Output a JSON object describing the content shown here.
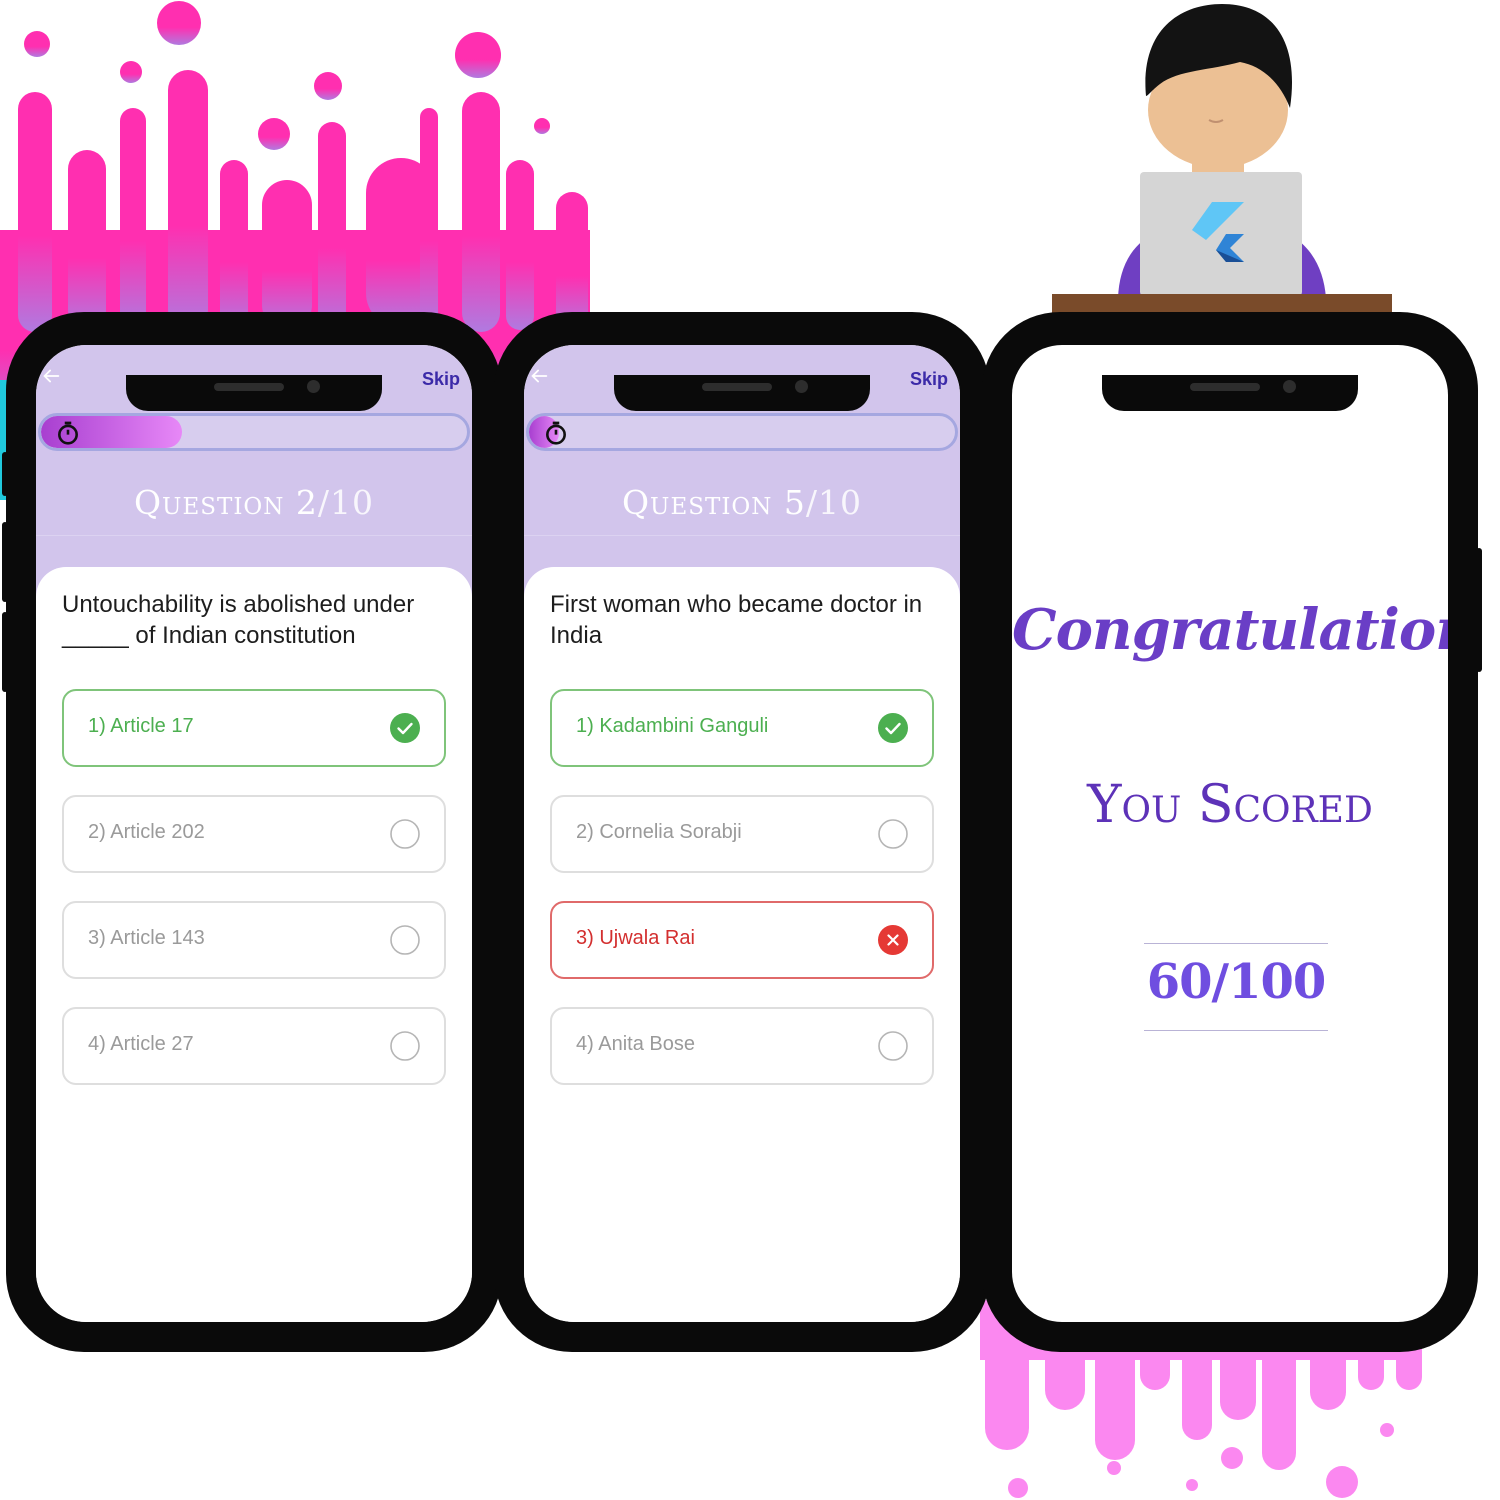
{
  "colors": {
    "accent_pink": "#ff2fb0",
    "lavender_header": "#d2c5ec",
    "correct_green": "#4caf50",
    "wrong_red": "#d32f2f",
    "brand_purple": "#6a3ec6"
  },
  "phones": [
    {
      "skip_label": "Skip",
      "timer_progress": 0.33,
      "question_title": "Question 2",
      "question_total": "/10",
      "question_text": "Untouchability is abolished under _____ of Indian constitution",
      "options": [
        {
          "label": "1) Article 17",
          "state": "correct",
          "icon": "check-circle-icon"
        },
        {
          "label": "2) Article 202",
          "state": "neutral",
          "icon": "empty-circle-icon"
        },
        {
          "label": "3) Article 143",
          "state": "neutral",
          "icon": "empty-circle-icon"
        },
        {
          "label": "4) Article 27",
          "state": "neutral",
          "icon": "empty-circle-icon"
        }
      ]
    },
    {
      "skip_label": "Skip",
      "timer_progress": 0.07,
      "question_title": "Question 5",
      "question_total": "/10",
      "question_text": "First woman who became doctor in India",
      "options": [
        {
          "label": "1) Kadambini Ganguli",
          "state": "correct",
          "icon": "check-circle-icon"
        },
        {
          "label": "2) Cornelia Sorabji",
          "state": "neutral",
          "icon": "empty-circle-icon"
        },
        {
          "label": "3) Ujwala Rai",
          "state": "wrong",
          "icon": "cross-circle-icon"
        },
        {
          "label": "4) Anita Bose",
          "state": "neutral",
          "icon": "empty-circle-icon"
        }
      ]
    }
  ],
  "result": {
    "congrats_text": "Congratulations !!",
    "scored_label": "You Scored",
    "score_value": "60/100"
  }
}
